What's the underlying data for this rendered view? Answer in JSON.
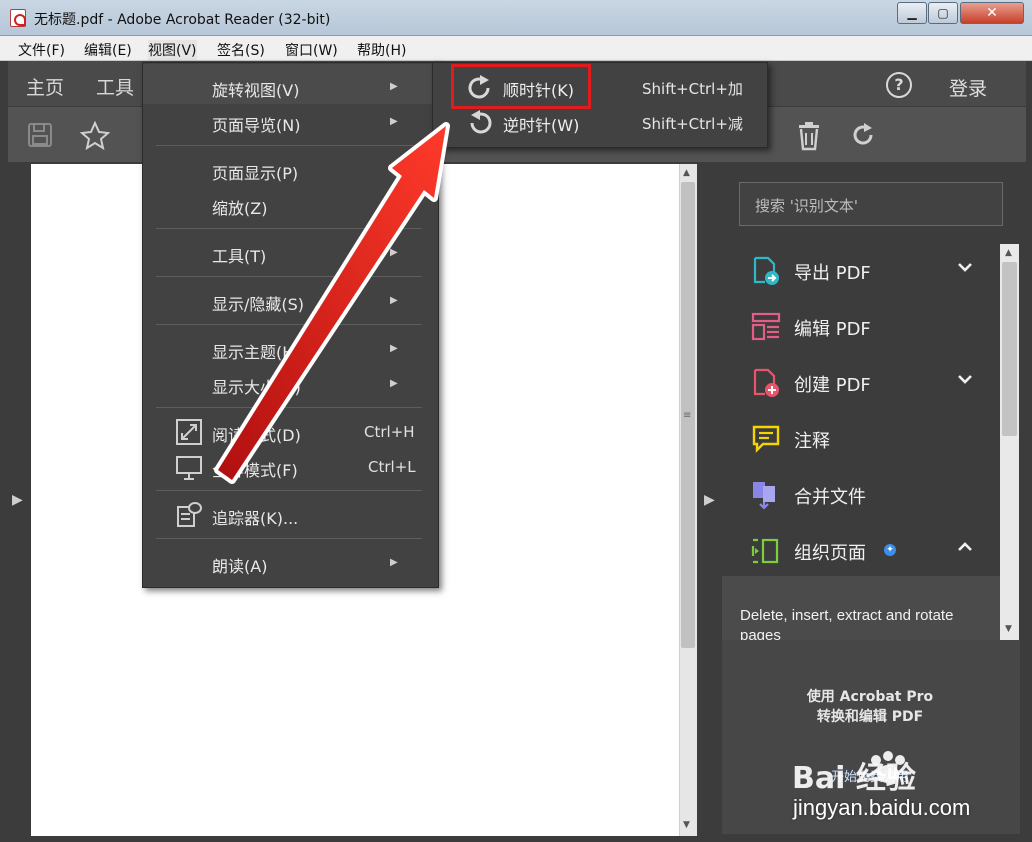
{
  "window": {
    "title": "无标题.pdf - Adobe Acrobat Reader (32-bit)",
    "minimize": "▁",
    "maximize": "▢",
    "close": "✕"
  },
  "menubar": [
    "文件(F)",
    "编辑(E)",
    "视图(V)",
    "签名(S)",
    "窗口(W)",
    "帮助(H)"
  ],
  "topnav": {
    "home": "主页",
    "tools": "工具",
    "help": "?",
    "login": "登录"
  },
  "view_menu": {
    "rotate": "旋转视图(V)",
    "page_nav": "页面导览(N)",
    "page_display": "页面显示(P)",
    "zoom": "缩放(Z)",
    "tools": "工具(T)",
    "show_hide": "显示/隐藏(S)",
    "theme": "显示主题(H)",
    "display_size": "显示大小(D)",
    "read_mode": "阅读模式(D)",
    "read_mode_shortcut": "Ctrl+H",
    "full_screen": "全屏模式(F)",
    "full_screen_shortcut": "Ctrl+L",
    "tracker": "追踪器(K)...",
    "read_aloud": "朗读(A)"
  },
  "rotate_submenu": {
    "clockwise": "顺时针(K)",
    "clockwise_shortcut": "Shift+Ctrl+加",
    "counterclockwise": "逆时针(W)",
    "counterclockwise_shortcut": "Shift+Ctrl+减"
  },
  "right_pane": {
    "search_placeholder": "搜索 '识别文本'",
    "tools": [
      {
        "label": "导出 PDF",
        "icon": "export-pdf-icon",
        "color": "#2fb8c7"
      },
      {
        "label": "编辑 PDF",
        "icon": "edit-pdf-icon",
        "color": "#e35d87"
      },
      {
        "label": "创建 PDF",
        "icon": "create-pdf-icon",
        "color": "#e9546b"
      },
      {
        "label": "注释",
        "icon": "comment-icon",
        "color": "#f5d400"
      },
      {
        "label": "合并文件",
        "icon": "combine-files-icon",
        "color": "#8a86e8"
      },
      {
        "label": "组织页面",
        "icon": "organize-pages-icon",
        "color": "#7ccf3b"
      }
    ],
    "organize_desc": "Delete, insert, extract and rotate pages",
    "promo_line1": "使用 Acrobat Pro",
    "promo_line2": "转换和编辑 PDF",
    "promo_trial": "开始免费试用"
  },
  "watermark": {
    "brand": "Bai 经验",
    "url": "jingyan.baidu.com"
  },
  "colors": {
    "highlight_box": "#e11b1b",
    "menu_bg": "#424242",
    "arrow": "#d91818"
  }
}
